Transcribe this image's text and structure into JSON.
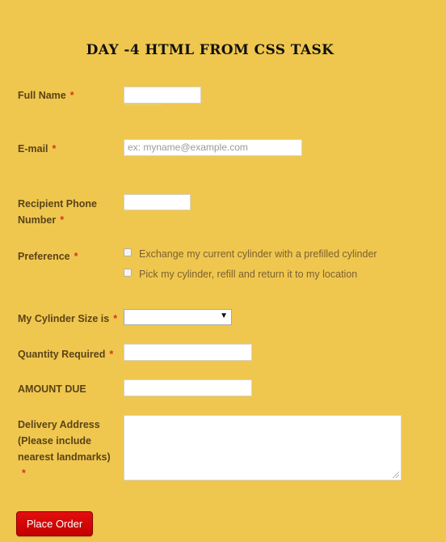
{
  "page": {
    "title": "DAY -4 HTML FROM CSS TASK"
  },
  "form": {
    "required_marker": "*",
    "full_name": {
      "label": "Full Name",
      "value": ""
    },
    "email": {
      "label": "E-mail",
      "placeholder": "ex: myname@example.com",
      "value": ""
    },
    "recipient_phone": {
      "label_line1": "Recipient Phone",
      "label_line2": "Number",
      "value": ""
    },
    "preference": {
      "label": "Preference",
      "options": [
        "Exchange my current cylinder with a prefilled cylinder",
        "Pick my cylinder, refill and return it to my location"
      ]
    },
    "cylinder_size": {
      "label": "My Cylinder Size is",
      "selected": ""
    },
    "quantity": {
      "label": "Quantity Required",
      "value": ""
    },
    "amount_due": {
      "label": "AMOUNT DUE",
      "value": ""
    },
    "delivery_address": {
      "label_line1": "Delivery Address",
      "label_line2": "(Please include",
      "label_line3": "nearest landmarks)",
      "value": ""
    },
    "submit_label": "Place Order"
  },
  "colors": {
    "background": "#efc74f",
    "label_text": "#5a4317",
    "required_star": "#d4371c",
    "button": "#d10808"
  },
  "icons": {
    "dropdown": "chevron-down-icon"
  }
}
